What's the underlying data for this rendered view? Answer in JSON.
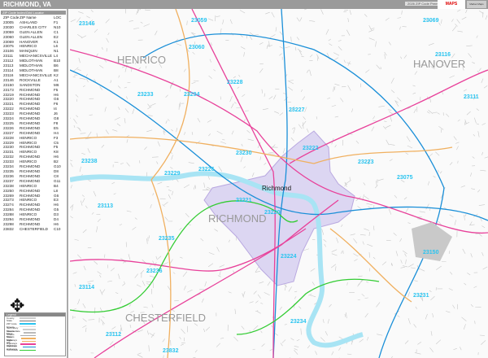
{
  "header": {
    "title": "RICHMOND, VA",
    "edition": "2026 ZIP Code Premium Edition",
    "brand": "MAPS",
    "brand_sub": "Market Maps"
  },
  "index": {
    "title": "ZIP Code Index/Grid Locator",
    "columns": [
      "ZIP Code",
      "ZIP Name",
      "LOC"
    ],
    "rows": [
      [
        "23005",
        "ASHLAND",
        "F1"
      ],
      [
        "23030",
        "CHARLES CITY",
        "N10"
      ],
      [
        "23059",
        "GLEN ALLEN",
        "C1"
      ],
      [
        "23060",
        "GLEN ALLEN",
        "E2"
      ],
      [
        "23069",
        "HANOVER",
        "K1"
      ],
      [
        "23075",
        "HENRICO",
        "L6"
      ],
      [
        "23106",
        "MANQUIN",
        "N1"
      ],
      [
        "23111",
        "MECHANICSVILLE",
        "L4"
      ],
      [
        "23112",
        "MIDLOTHIAN",
        "B10"
      ],
      [
        "23113",
        "MIDLOTHIAN",
        "B6"
      ],
      [
        "23114",
        "MIDLOTHIAN",
        "B8"
      ],
      [
        "23116",
        "MECHANICSVILLE",
        "K2"
      ],
      [
        "23146",
        "ROCKVILLE",
        "A1"
      ],
      [
        "23150",
        "SANDSTON",
        "M6"
      ],
      [
        "23173",
        "RICHMOND",
        "F5"
      ],
      [
        "23219",
        "RICHMOND",
        "H6"
      ],
      [
        "23220",
        "RICHMOND",
        "G6"
      ],
      [
        "23221",
        "RICHMOND",
        "F6"
      ],
      [
        "23222",
        "RICHMOND",
        "I4"
      ],
      [
        "23223",
        "RICHMOND",
        "J6"
      ],
      [
        "23224",
        "RICHMOND",
        "G8"
      ],
      [
        "23225",
        "RICHMOND",
        "F8"
      ],
      [
        "23226",
        "RICHMOND",
        "E5"
      ],
      [
        "23227",
        "RICHMOND",
        "H4"
      ],
      [
        "23228",
        "HENRICO",
        "F3"
      ],
      [
        "23229",
        "HENRICO",
        "C5"
      ],
      [
        "23230",
        "RICHMOND",
        "F5"
      ],
      [
        "23231",
        "HENRICO",
        "K8"
      ],
      [
        "23232",
        "RICHMOND",
        "H6"
      ],
      [
        "23233",
        "HENRICO",
        "B2"
      ],
      [
        "23234",
        "RICHMOND",
        "G10"
      ],
      [
        "23235",
        "RICHMOND",
        "D8"
      ],
      [
        "23236",
        "RICHMOND",
        "C8"
      ],
      [
        "23237",
        "RICHMOND",
        "G11"
      ],
      [
        "23238",
        "HENRICO",
        "B4"
      ],
      [
        "23250",
        "RICHMOND",
        "L8"
      ],
      [
        "23269",
        "RICHMOND",
        "G6"
      ],
      [
        "23273",
        "HENRICO",
        "E3"
      ],
      [
        "23274",
        "RICHMOND",
        "H6"
      ],
      [
        "23284",
        "RICHMOND",
        "G5"
      ],
      [
        "23288",
        "HENRICO",
        "D3"
      ],
      [
        "23294",
        "RICHMOND",
        "D4"
      ],
      [
        "23298",
        "RICHMOND",
        "H6"
      ],
      [
        "23832",
        "CHESTERFIELD",
        "C10"
      ]
    ]
  },
  "legend": {
    "title": "Legend",
    "items": [
      "County",
      "State",
      "ZIP Code",
      "Streets",
      "Secondary Streets",
      "Intermediate Streets",
      "Major Streets",
      "Main Highways",
      "Major Highways",
      "US Highways",
      "Interstate Highways",
      "Toll Roads"
    ]
  },
  "map": {
    "counties": [
      "HENRICO",
      "HANOVER",
      "CHESTERFIELD",
      "RICHMOND"
    ],
    "city": "Richmond",
    "zips": [
      "23146",
      "23059",
      "23069",
      "23060",
      "23116",
      "23111",
      "23228",
      "23233",
      "23294",
      "23227",
      "23222",
      "23223",
      "23075",
      "23238",
      "23226",
      "23229",
      "23230",
      "23113",
      "23221",
      "23220",
      "23235",
      "23224",
      "23236",
      "23150",
      "23114",
      "23231",
      "23234",
      "23112",
      "23832"
    ],
    "colors": {
      "city": "#dcd6f2",
      "river": "#a8e4f4",
      "zip": "#2ac4f0",
      "interstate": "#1a8fd8",
      "us": "#e8419a",
      "state": "#f0b060",
      "toll": "#33cc33"
    }
  }
}
